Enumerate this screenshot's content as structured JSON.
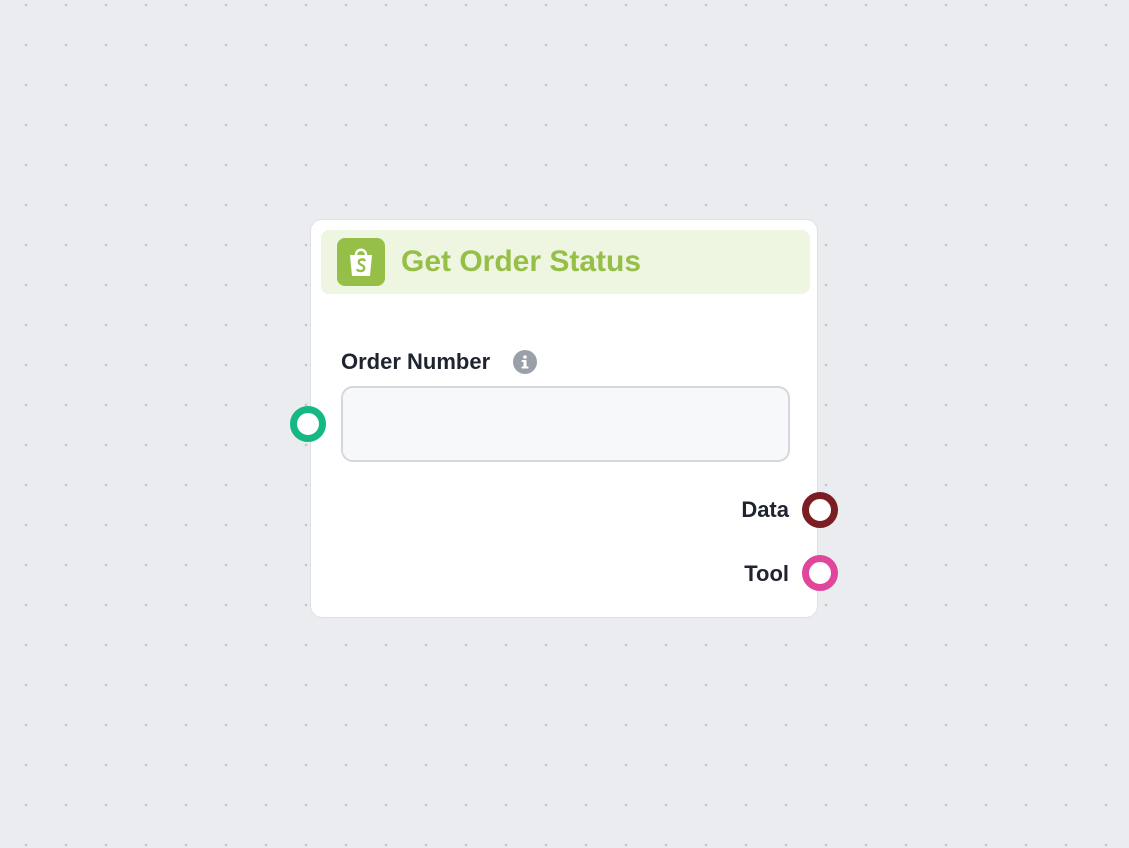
{
  "node": {
    "title": "Get Order Status",
    "icon": "shopify-bag-icon",
    "accent_color": "#95bf47",
    "header_bg_color": "#eef5e1"
  },
  "field": {
    "label": "Order Number",
    "info_icon": "info-icon",
    "value": "",
    "placeholder": ""
  },
  "outputs": [
    {
      "label": "Data",
      "color": "#7b1e24"
    },
    {
      "label": "Tool",
      "color": "#e0479a"
    }
  ],
  "input_handle": {
    "color": "#13b883"
  }
}
